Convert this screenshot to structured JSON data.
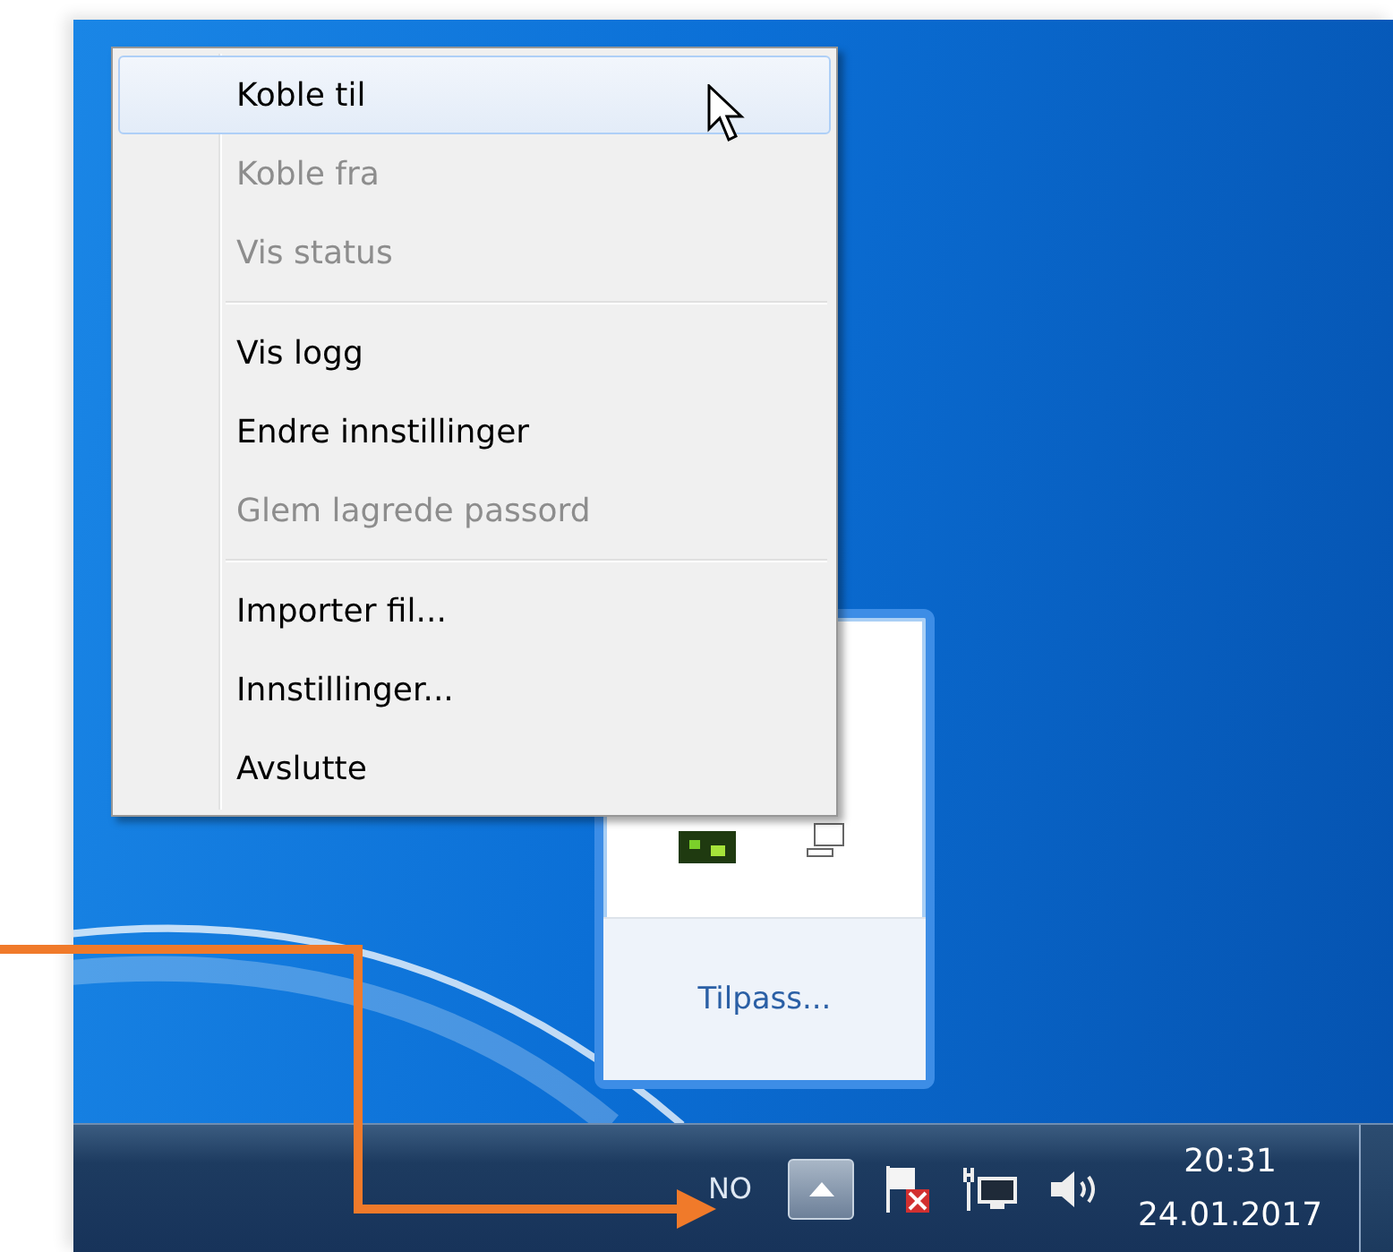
{
  "context_menu": {
    "groups": [
      {
        "items": [
          {
            "label": "Koble til",
            "selected": true,
            "disabled": false
          },
          {
            "label": "Koble fra",
            "selected": false,
            "disabled": true
          },
          {
            "label": "Vis status",
            "selected": false,
            "disabled": true
          }
        ]
      },
      {
        "items": [
          {
            "label": "Vis logg",
            "selected": false,
            "disabled": false
          },
          {
            "label": "Endre innstillinger",
            "selected": false,
            "disabled": false
          },
          {
            "label": "Glem lagrede passord",
            "selected": false,
            "disabled": true
          }
        ]
      },
      {
        "items": [
          {
            "label": "Importer fil...",
            "selected": false,
            "disabled": false
          },
          {
            "label": "Innstillinger...",
            "selected": false,
            "disabled": false
          },
          {
            "label": "Avslutte",
            "selected": false,
            "disabled": false
          }
        ]
      }
    ]
  },
  "tray_popup": {
    "link": "Tilpass..."
  },
  "taskbar": {
    "language": "NO",
    "time": "20:31",
    "date": "24.01.2017"
  }
}
